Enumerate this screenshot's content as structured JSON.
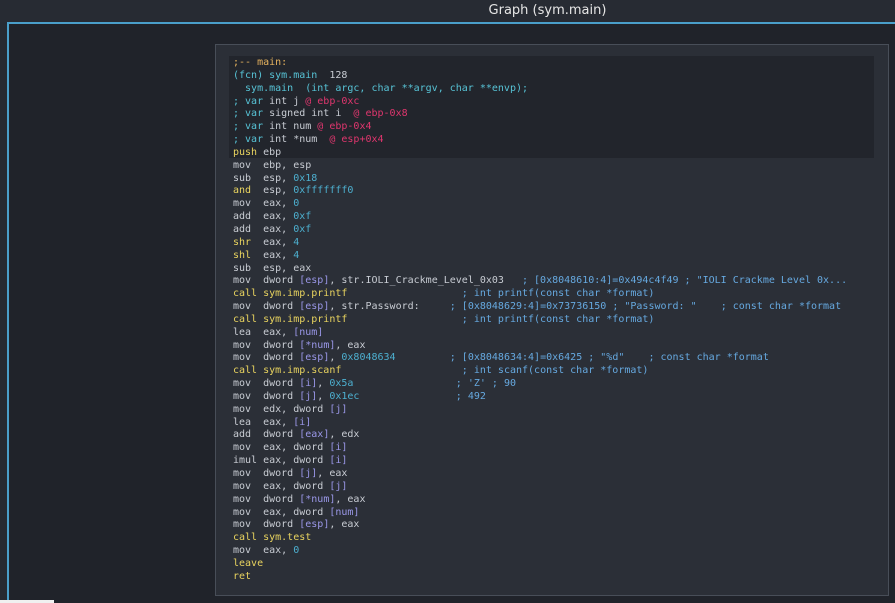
{
  "window": {
    "title": "Graph (sym.main)"
  },
  "colors": {
    "accent": "#4a9fca",
    "label": "#e5b25e",
    "symbol": "#57c3d6",
    "var_offset": "#e0366e",
    "control_flow": "#e8d35f",
    "comment": "#66a9e0",
    "text": "#c8ccd3"
  },
  "code": [
    [
      {
        "t": ";-- main:",
        "c": "or"
      }
    ],
    [
      {
        "t": "(fcn) ",
        "c": "cy"
      },
      {
        "t": "sym.main",
        "c": "cy"
      },
      {
        "t": "  128",
        "c": "tx"
      }
    ],
    [
      {
        "t": "  sym.main  (int argc, char **argv, char **envp);",
        "c": "cy"
      }
    ],
    [
      {
        "t": "; var ",
        "c": "cy"
      },
      {
        "t": "int j ",
        "c": "tx"
      },
      {
        "t": "@ ebp-0xc",
        "c": "mg"
      }
    ],
    [
      {
        "t": "; var ",
        "c": "cy"
      },
      {
        "t": "signed int i  ",
        "c": "tx"
      },
      {
        "t": "@ ebp-0x8",
        "c": "mg"
      }
    ],
    [
      {
        "t": "; var ",
        "c": "cy"
      },
      {
        "t": "int num ",
        "c": "tx"
      },
      {
        "t": "@ ebp-0x4",
        "c": "mg"
      }
    ],
    [
      {
        "t": "; var ",
        "c": "cy"
      },
      {
        "t": "int *num  ",
        "c": "tx"
      },
      {
        "t": "@ esp+0x4",
        "c": "mg"
      }
    ],
    [
      {
        "t": "push",
        "c": "ye"
      },
      {
        "t": " ebp",
        "c": "tx"
      }
    ],
    [
      {
        "t": "mov  ebp, esp",
        "c": "tx"
      }
    ],
    [
      {
        "t": "sub  esp, ",
        "c": "tx"
      },
      {
        "t": "0x18",
        "c": "nm"
      }
    ],
    [
      {
        "t": "and",
        "c": "ye"
      },
      {
        "t": "  esp, ",
        "c": "tx"
      },
      {
        "t": "0xfffffff0",
        "c": "nm"
      }
    ],
    [
      {
        "t": "mov  eax, ",
        "c": "tx"
      },
      {
        "t": "0",
        "c": "nm"
      }
    ],
    [
      {
        "t": "add  eax, ",
        "c": "tx"
      },
      {
        "t": "0xf",
        "c": "nm"
      }
    ],
    [
      {
        "t": "add  eax, ",
        "c": "tx"
      },
      {
        "t": "0xf",
        "c": "nm"
      }
    ],
    [
      {
        "t": "shr",
        "c": "ye"
      },
      {
        "t": "  eax, ",
        "c": "tx"
      },
      {
        "t": "4",
        "c": "nm"
      }
    ],
    [
      {
        "t": "shl",
        "c": "ye"
      },
      {
        "t": "  eax, ",
        "c": "tx"
      },
      {
        "t": "4",
        "c": "nm"
      }
    ],
    [
      {
        "t": "sub  esp, eax",
        "c": "tx"
      }
    ],
    [
      {
        "t": "mov  dword ",
        "c": "tx"
      },
      {
        "t": "[esp]",
        "c": "ar"
      },
      {
        "t": ", str.IOLI_Crackme_Level_0x03   ",
        "c": "tx"
      },
      {
        "t": "; [0x8048610:4]=0x494c4f49 ; \"IOLI Crackme Level 0x...",
        "c": "cm"
      }
    ],
    [
      {
        "t": "call sym.imp.printf",
        "c": "ye"
      },
      {
        "t": "                   ",
        "c": "tx"
      },
      {
        "t": "; int printf(const char *format)",
        "c": "cm"
      }
    ],
    [
      {
        "t": "mov  dword ",
        "c": "tx"
      },
      {
        "t": "[esp]",
        "c": "ar"
      },
      {
        "t": ", str.Password:     ",
        "c": "tx"
      },
      {
        "t": "; [0x8048629:4]=0x73736150 ; \"Password: \"    ; const char *format",
        "c": "cm"
      }
    ],
    [
      {
        "t": "call sym.imp.printf",
        "c": "ye"
      },
      {
        "t": "                   ",
        "c": "tx"
      },
      {
        "t": "; int printf(const char *format)",
        "c": "cm"
      }
    ],
    [
      {
        "t": "lea  eax, ",
        "c": "tx"
      },
      {
        "t": "[num]",
        "c": "ar"
      }
    ],
    [
      {
        "t": "mov  dword ",
        "c": "tx"
      },
      {
        "t": "[*num]",
        "c": "ar"
      },
      {
        "t": ", eax",
        "c": "tx"
      }
    ],
    [
      {
        "t": "mov  dword ",
        "c": "tx"
      },
      {
        "t": "[esp]",
        "c": "ar"
      },
      {
        "t": ", ",
        "c": "tx"
      },
      {
        "t": "0x8048634",
        "c": "nm"
      },
      {
        "t": "         ",
        "c": "tx"
      },
      {
        "t": "; [0x8048634:4]=0x6425 ; \"%d\"    ; const char *format",
        "c": "cm"
      }
    ],
    [
      {
        "t": "call sym.imp.scanf",
        "c": "ye"
      },
      {
        "t": "                    ",
        "c": "tx"
      },
      {
        "t": "; int scanf(const char *format)",
        "c": "cm"
      }
    ],
    [
      {
        "t": "mov  dword ",
        "c": "tx"
      },
      {
        "t": "[i]",
        "c": "ar"
      },
      {
        "t": ", ",
        "c": "tx"
      },
      {
        "t": "0x5a",
        "c": "nm"
      },
      {
        "t": "                 ",
        "c": "tx"
      },
      {
        "t": "; 'Z' ; 90",
        "c": "cm"
      }
    ],
    [
      {
        "t": "mov  dword ",
        "c": "tx"
      },
      {
        "t": "[j]",
        "c": "ar"
      },
      {
        "t": ", ",
        "c": "tx"
      },
      {
        "t": "0x1ec",
        "c": "nm"
      },
      {
        "t": "                ",
        "c": "tx"
      },
      {
        "t": "; 492",
        "c": "cm"
      }
    ],
    [
      {
        "t": "mov  edx, dword ",
        "c": "tx"
      },
      {
        "t": "[j]",
        "c": "ar"
      }
    ],
    [
      {
        "t": "lea  eax, ",
        "c": "tx"
      },
      {
        "t": "[i]",
        "c": "ar"
      }
    ],
    [
      {
        "t": "add  dword ",
        "c": "tx"
      },
      {
        "t": "[eax]",
        "c": "ar"
      },
      {
        "t": ", edx",
        "c": "tx"
      }
    ],
    [
      {
        "t": "mov  eax, dword ",
        "c": "tx"
      },
      {
        "t": "[i]",
        "c": "ar"
      }
    ],
    [
      {
        "t": "imul eax, dword ",
        "c": "tx"
      },
      {
        "t": "[i]",
        "c": "ar"
      }
    ],
    [
      {
        "t": "mov  dword ",
        "c": "tx"
      },
      {
        "t": "[j]",
        "c": "ar"
      },
      {
        "t": ", eax",
        "c": "tx"
      }
    ],
    [
      {
        "t": "mov  eax, dword ",
        "c": "tx"
      },
      {
        "t": "[j]",
        "c": "ar"
      }
    ],
    [
      {
        "t": "mov  dword ",
        "c": "tx"
      },
      {
        "t": "[*num]",
        "c": "ar"
      },
      {
        "t": ", eax",
        "c": "tx"
      }
    ],
    [
      {
        "t": "mov  eax, dword ",
        "c": "tx"
      },
      {
        "t": "[num]",
        "c": "ar"
      }
    ],
    [
      {
        "t": "mov  dword ",
        "c": "tx"
      },
      {
        "t": "[esp]",
        "c": "ar"
      },
      {
        "t": ", eax",
        "c": "tx"
      }
    ],
    [
      {
        "t": "call sym.test",
        "c": "ye"
      }
    ],
    [
      {
        "t": "mov  eax, ",
        "c": "tx"
      },
      {
        "t": "0",
        "c": "nm"
      }
    ],
    [
      {
        "t": "leave",
        "c": "ye"
      }
    ],
    [
      {
        "t": "ret",
        "c": "ye"
      }
    ]
  ]
}
